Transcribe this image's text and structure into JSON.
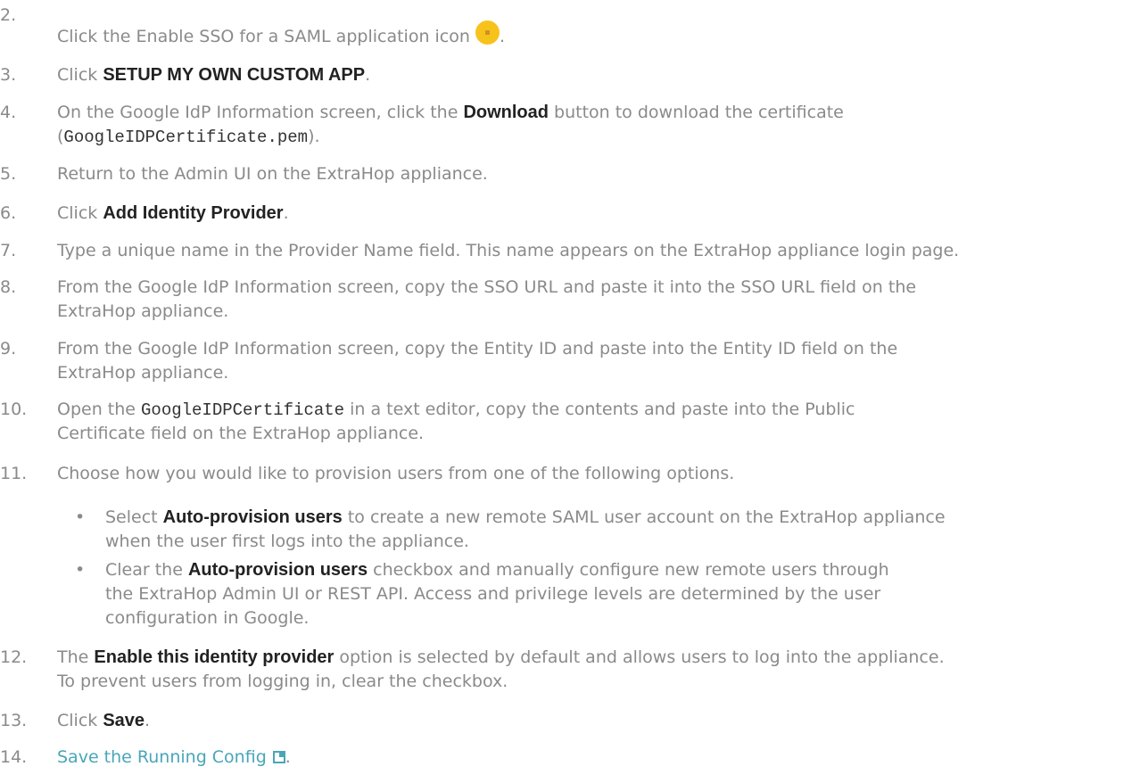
{
  "steps": [
    {
      "num": "2.",
      "pre": "Click the Enable SSO for a SAML application icon",
      "post": "."
    },
    {
      "num": "3.",
      "pre": "Click ",
      "bold": "SETUP MY OWN CUSTOM APP",
      "post": "."
    },
    {
      "num": "4.",
      "pre": "On the Google IdP Information screen, click the ",
      "bold": "Download",
      "post": " button to download the certificate",
      "line2_pre": "(",
      "code": "GoogleIDPCertificate.pem",
      "line2_post": ")."
    },
    {
      "num": "5.",
      "text": "Return to the Admin UI on the ExtraHop appliance."
    },
    {
      "num": "6.",
      "pre": "Click ",
      "bold": "Add Identity Provider",
      "post": "."
    },
    {
      "num": "7.",
      "text": "Type a unique name in the Provider Name field. This name appears on the ExtraHop appliance login page."
    },
    {
      "num": "8.",
      "line1": "From the Google IdP Information screen, copy the SSO URL and paste it into the SSO URL field on the",
      "line2": "ExtraHop appliance."
    },
    {
      "num": "9.",
      "line1": "From the Google IdP Information screen, copy the Entity ID and paste into the Entity ID field on the",
      "line2": "ExtraHop appliance."
    },
    {
      "num": "10.",
      "pre": "Open the ",
      "code": "GoogleIDPCertificate",
      "post": " in a text editor, copy the contents and paste into the Public",
      "line2": "Certificate field on the ExtraHop appliance."
    },
    {
      "num": "11.",
      "text": "Choose how you would like to provision users from one of the following options."
    },
    {
      "num": "12.",
      "pre": "The ",
      "bold": "Enable this identity provider",
      "post": " option is selected by default and allows users to log into the appliance.",
      "line2": "To prevent users from logging in, clear the checkbox."
    },
    {
      "num": "13.",
      "pre": "Click ",
      "bold": "Save",
      "post": "."
    },
    {
      "num": "14.",
      "link": "Save the Running Config",
      "post": "."
    }
  ],
  "bullets": [
    {
      "marker": "•",
      "pre": "Select ",
      "bold": "Auto-provision users",
      "post": " to create a new remote SAML user account on the ExtraHop appliance",
      "line2": "when the user first logs into the appliance."
    },
    {
      "marker": "•",
      "pre": "Clear the ",
      "bold": "Auto-provision users",
      "post": " checkbox and manually configure new remote users through",
      "line2": "the ExtraHop Admin UI or REST API. Access and privilege levels are determined by the user",
      "line3": "configuration in Google."
    }
  ],
  "icons": {
    "sso": "sso-app-icon",
    "sso_color": "#f8c21d",
    "external_link": "external-link-icon",
    "link_color": "#49a6b8"
  }
}
